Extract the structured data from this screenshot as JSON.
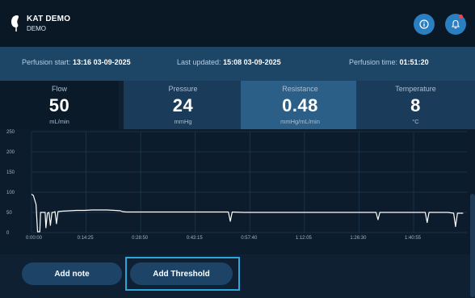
{
  "header": {
    "title": "KAT DEMO",
    "subtitle": "DEMO",
    "icons": [
      "kidney-logo",
      "info-icon",
      "bell-icon"
    ],
    "notification_dot_color": "#e8474c"
  },
  "infobar": {
    "start_label": "Perfusion start:",
    "start_value": "13:16  03-09-2025",
    "updated_label": "Last updated:",
    "updated_value": "15:08  03-09-2025",
    "time_label": "Perfusion time:",
    "time_value": "01:51:20"
  },
  "metrics": [
    {
      "label": "Flow",
      "value": "50",
      "unit": "mL/min"
    },
    {
      "label": "Pressure",
      "value": "24",
      "unit": "mmHg"
    },
    {
      "label": "Resistance",
      "value": "0.48",
      "unit": "mmHg/mL/min"
    },
    {
      "label": "Temperature",
      "value": "8",
      "unit": "°C"
    }
  ],
  "chart_data": {
    "type": "line",
    "ylim": [
      0,
      250
    ],
    "yticks": [
      "250",
      "200",
      "150",
      "100",
      "50",
      "0"
    ],
    "xticks": [
      "0:00:00",
      "0:14:25",
      "0:28:50",
      "0:43:15",
      "0:57:40",
      "1:12:05",
      "1:26:30",
      "1:40:55"
    ],
    "grid": true,
    "series": [
      {
        "color": "#ffffff",
        "points": [
          [
            0,
            95
          ],
          [
            0.5,
            92
          ],
          [
            1.2,
            70
          ],
          [
            1.6,
            2
          ],
          [
            2.2,
            2
          ],
          [
            2.4,
            50
          ],
          [
            3.0,
            50
          ],
          [
            3.6,
            50
          ],
          [
            3.8,
            12
          ],
          [
            4.2,
            48
          ],
          [
            4.6,
            50
          ],
          [
            5.0,
            18
          ],
          [
            5.4,
            50
          ],
          [
            5.8,
            50
          ],
          [
            6.2,
            52
          ],
          [
            6.6,
            22
          ],
          [
            7.0,
            52
          ],
          [
            8,
            53
          ],
          [
            10,
            54
          ],
          [
            12,
            55
          ],
          [
            14,
            55
          ],
          [
            16,
            56
          ],
          [
            18,
            56
          ],
          [
            20,
            56
          ],
          [
            22,
            55
          ],
          [
            23.5,
            54
          ],
          [
            24,
            52
          ],
          [
            25,
            51
          ],
          [
            30,
            51
          ],
          [
            35,
            51
          ],
          [
            40,
            51
          ],
          [
            45,
            51
          ],
          [
            50,
            51
          ],
          [
            52,
            51
          ],
          [
            52.5,
            28
          ],
          [
            53,
            51
          ],
          [
            56,
            50
          ],
          [
            60,
            50
          ],
          [
            65,
            50
          ],
          [
            70,
            50
          ],
          [
            75,
            50
          ],
          [
            80,
            50
          ],
          [
            85,
            50
          ],
          [
            90,
            50
          ],
          [
            91,
            50
          ],
          [
            91.5,
            32
          ],
          [
            92,
            50
          ],
          [
            96,
            50
          ],
          [
            100,
            50
          ],
          [
            104,
            50
          ],
          [
            104.5,
            25
          ],
          [
            105,
            50
          ],
          [
            108,
            50
          ],
          [
            110,
            50
          ],
          [
            111.5,
            48
          ],
          [
            112,
            15
          ],
          [
            112.5,
            48
          ],
          [
            114,
            48
          ]
        ]
      }
    ]
  },
  "buttons": {
    "add_note": "Add note",
    "add_threshold": "Add Threshold"
  }
}
